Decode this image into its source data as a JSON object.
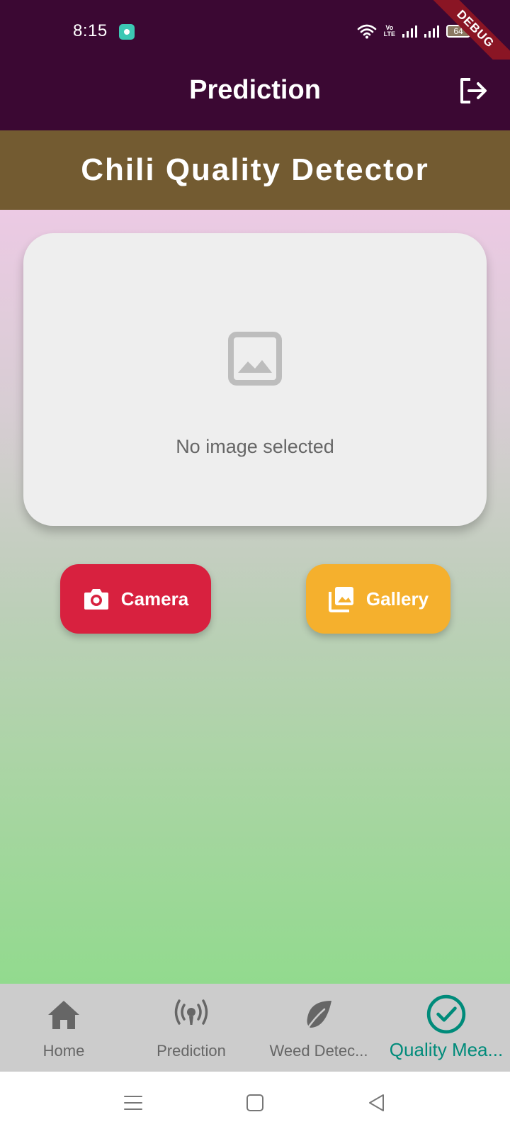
{
  "status_bar": {
    "time": "8:15",
    "volte_line1": "Vo",
    "volte_line2": "LTE",
    "battery_level": "64"
  },
  "debug_banner": "DEBUG",
  "app_bar": {
    "title": "Prediction",
    "logout_icon": "logout-icon"
  },
  "header": {
    "title": "Chili Quality Detector"
  },
  "image_card": {
    "placeholder_icon": "image-icon",
    "message": "No image selected"
  },
  "actions": {
    "camera_label": "Camera",
    "camera_icon": "camera-icon",
    "gallery_label": "Gallery",
    "gallery_icon": "photo-library-icon"
  },
  "bottom_nav": {
    "items": [
      {
        "label": "Home",
        "icon": "home-icon",
        "active": false
      },
      {
        "label": "Prediction",
        "icon": "sensors-icon",
        "active": false
      },
      {
        "label": "Weed Detec...",
        "icon": "leaf-icon",
        "active": false
      },
      {
        "label": "Quality Mea...",
        "icon": "check-circle-icon",
        "active": true
      }
    ]
  },
  "colors": {
    "app_bar": "#3b0833",
    "header_band": "#735b31",
    "camera_button": "#d8213f",
    "gallery_button": "#f5b02d",
    "active_nav": "#008b7a",
    "inactive_nav": "#666666",
    "gradient_top": "#eccae4",
    "gradient_bottom": "#92da8e"
  }
}
